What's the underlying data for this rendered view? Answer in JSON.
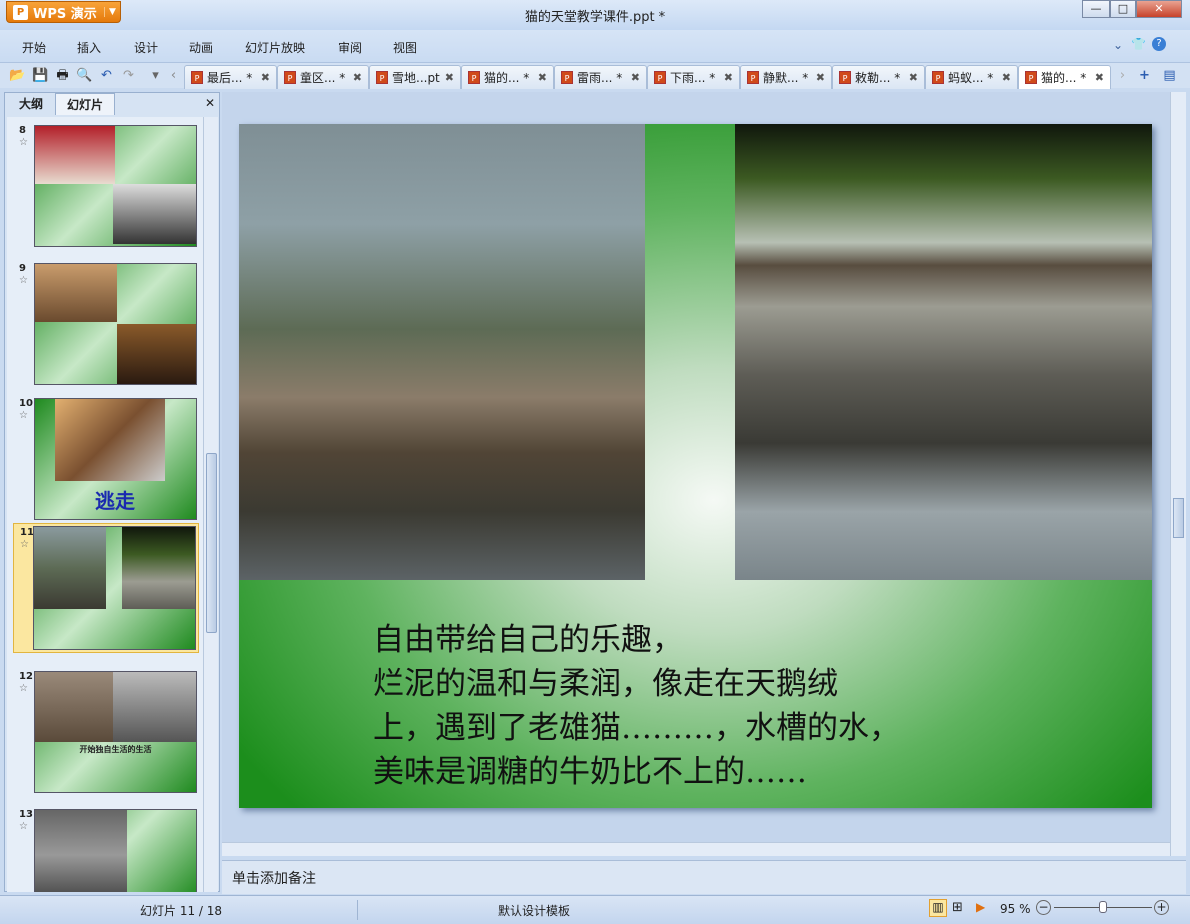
{
  "app": {
    "name": "WPS 演示",
    "title": "猫的天堂教学课件.ppt *"
  },
  "window": {
    "minimize": "—",
    "maximize": "□",
    "close": "✕"
  },
  "menu": [
    "开始",
    "插入",
    "设计",
    "动画",
    "幻灯片放映",
    "审阅",
    "视图"
  ],
  "doc_tabs": [
    {
      "label": "最后... *"
    },
    {
      "label": "童区... *"
    },
    {
      "label": "雪地...pt"
    },
    {
      "label": "猫的... *"
    },
    {
      "label": "雷雨... *"
    },
    {
      "label": "下雨... *"
    },
    {
      "label": "静默... *"
    },
    {
      "label": "敕勒... *"
    },
    {
      "label": "蚂蚁... *"
    },
    {
      "label": "猫的... *",
      "active": true
    }
  ],
  "panel": {
    "tabs": [
      "大纲",
      "幻灯片"
    ],
    "active_tab": "幻灯片",
    "close": "✕"
  },
  "thumbnails": [
    {
      "num": "8",
      "star": "☆"
    },
    {
      "num": "9",
      "star": "☆"
    },
    {
      "num": "10",
      "star": "☆",
      "title": "逃走"
    },
    {
      "num": "11",
      "star": "☆",
      "selected": true
    },
    {
      "num": "12",
      "star": "☆",
      "caption": "开始独自生活的生活"
    },
    {
      "num": "13",
      "star": "☆"
    }
  ],
  "slide": {
    "lines": [
      "自由带给自己的乐趣，",
      "烂泥的温和与柔润，像走在天鹅绒",
      "上，遇到了老雄猫………，水槽的水，",
      "美味是调糖的牛奶比不上的……"
    ]
  },
  "notes": {
    "placeholder": "单击添加备注"
  },
  "status": {
    "slide_count": "幻灯片 11 / 18",
    "template": "默认设计模板",
    "zoom": "95 %",
    "zoom_fraction": 0.5
  }
}
